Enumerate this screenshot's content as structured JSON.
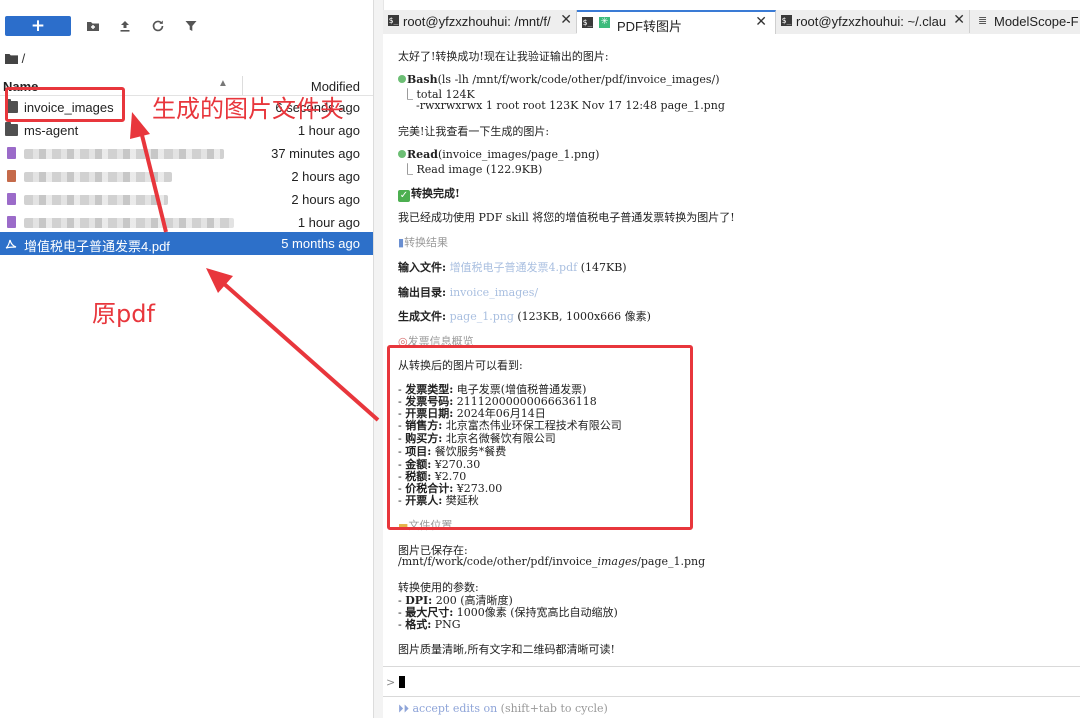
{
  "file_browser": {
    "new_button_label": "+",
    "breadcrumb": "/",
    "columns": {
      "name": "Name",
      "modified": "Modified"
    },
    "rows": [
      {
        "name": "invoice_images",
        "modified": "6 seconds ago",
        "kind": "folder"
      },
      {
        "name": "ms-agent",
        "modified": "1 hour ago",
        "kind": "folder"
      },
      {
        "name": "",
        "modified": "37 minutes ago",
        "kind": "file-blurred"
      },
      {
        "name": "",
        "modified": "2 hours ago",
        "kind": "file-blurred"
      },
      {
        "name": "",
        "modified": "2 hours ago",
        "kind": "file-blurred"
      },
      {
        "name": "",
        "modified": "1 hour ago",
        "kind": "file-blurred"
      },
      {
        "name": "增值税电子普通发票4.pdf",
        "modified": "5 months ago",
        "kind": "pdf",
        "selected": true
      }
    ]
  },
  "tabs": [
    {
      "label": "root@yfzxzhouhui: /mnt/f/",
      "active": false
    },
    {
      "label": "PDF转图片",
      "active": true
    },
    {
      "label": "root@yfzxzhouhui: ~/.clau",
      "active": false
    },
    {
      "label": "ModelScope-F",
      "active": false
    }
  ],
  "terminal": {
    "lines": {
      "l1": "太好了!转换成功!现在让我验证输出的图片:",
      "l2_cmd": "Bash",
      "l2_arg": "(ls -lh /mnt/f/work/code/other/pdf/invoice_images/)",
      "l3": "⎿ total 124K",
      "l4": "-rwxrwxrwx 1 root root 123K Nov 17 12:48 page_1.png",
      "l5": "完美!让我查看一下生成的图片:",
      "l6_cmd": "Read",
      "l6_arg": "(invoice_images/page_1.png)",
      "l7": "⎿ Read image (122.9KB)",
      "l8": "转换完成!",
      "l9": "我已经成功使用 PDF skill 将您的增值税电子普通发票转换为图片了!",
      "l10": "转换结果",
      "l11_label": "输入文件:",
      "l11_link": "增值税电子普通发票4.pdf",
      "l11_rest": " (147KB)",
      "l12_label": "输出目录:",
      "l12_link": "invoice_images/",
      "l13_label": "生成文件:",
      "l13_link": "page_1.png",
      "l13_rest": " (123KB, 1000x666 像素)",
      "l14": "发票信息概览",
      "l15": "从转换后的图片可以看到:",
      "inv1_k": "发票类型:",
      "inv1_v": " 电子发票(增值税普通发票)",
      "inv2_k": "发票号码:",
      "inv2_v": " 21112000000066636118",
      "inv3_k": "开票日期:",
      "inv3_v": " 2024年06月14日",
      "inv4_k": "销售方:",
      "inv4_v": " 北京富杰伟业环保工程技术有限公司",
      "inv5_k": "购买方:",
      "inv5_v": " 北京名微餐饮有限公司",
      "inv6_k": "项目:",
      "inv6_v": " 餐饮服务*餐费",
      "inv7_k": "金额:",
      "inv7_v": " ¥270.30",
      "inv8_k": "税额:",
      "inv8_v": " ¥2.70",
      "inv9_k": "价税合计:",
      "inv9_v": " ¥273.00",
      "inv10_k": "开票人:",
      "inv10_v": " 樊延秋",
      "l16": "文件位置",
      "l17": "图片已保存在:",
      "l18a": "/mnt/f/work/code/other/pdf/invoice_",
      "l18b": "images",
      "l18c": "/page_",
      "l18d": "1.png",
      "l19": "转换使用的参数:",
      "p1_k": "DPI:",
      "p1_v": " 200 (高清晰度)",
      "p2_k": "最大尺寸:",
      "p2_v": " 1000像素 (保持宽高比自动缩放)",
      "p3_k": "格式:",
      "p3_v": " PNG",
      "l20": "图片质量清晰,所有文字和二维码都清晰可读!",
      "prompt": ">",
      "accept": "⏵⏵ accept edits on",
      "accept_hint": " (shift+tab to cycle)"
    }
  },
  "annotations": {
    "folder_note": "生成的图片文件夹",
    "pdf_note": "原pdf",
    "accent_color": "#e8363c"
  }
}
